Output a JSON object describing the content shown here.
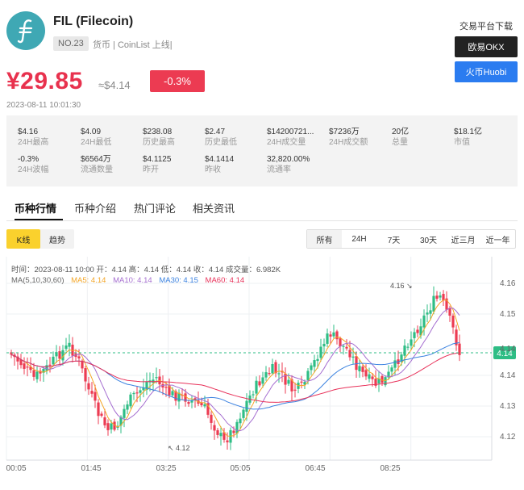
{
  "header": {
    "name": "FIL (Filecoin)",
    "rank": "NO.23",
    "tags": "货币 | CoinList 上线|",
    "price_cny": "¥29.85",
    "price_usd": "≈$4.14",
    "change": "-0.3%",
    "timestamp": "2023-08-11 10:01:30"
  },
  "exchange": {
    "title": "交易平台下载",
    "okx": "欧易OKX",
    "huobi": "火币Huobi"
  },
  "stats": [
    {
      "value": "$4.16",
      "label": "24H最高"
    },
    {
      "value": "$4.09",
      "label": "24H最低"
    },
    {
      "value": "$238.08",
      "label": "历史最高"
    },
    {
      "value": "$2.47",
      "label": "历史最低"
    },
    {
      "value": "$14200721...",
      "label": "24H成交量"
    },
    {
      "value": "$7236万",
      "label": "24H成交额"
    },
    {
      "value": "20亿",
      "label": "总量"
    },
    {
      "value": "$18.1亿",
      "label": "市值"
    },
    {
      "value": "-0.3%",
      "label": "24H波幅"
    },
    {
      "value": "$6564万",
      "label": "流通数量"
    },
    {
      "value": "$4.1125",
      "label": "昨开"
    },
    {
      "value": "$4.1414",
      "label": "昨收"
    },
    {
      "value": "32,820.00%",
      "label": "流通率"
    }
  ],
  "tabs": [
    "币种行情",
    "币种介绍",
    "热门评论",
    "相关资讯"
  ],
  "chart_types": [
    "K线",
    "趋势"
  ],
  "ranges": [
    "所有",
    "24H",
    "7天",
    "30天",
    "近三月",
    "近一年"
  ],
  "chart_info": {
    "line1": "时间：2023-08-11 10:00    开：4.14    高：4.14    低：4.14    收：4.14    成交量：6.982K",
    "ma_label": "MA(5,10,30,60)",
    "ma5": "MA5: 4.14",
    "ma10": "MA10: 4.14",
    "ma30": "MA30: 4.15",
    "ma60": "MA60: 4.14"
  },
  "chart_data": {
    "type": "candlestick",
    "ylim": [
      4.115,
      4.165
    ],
    "yticks": [
      "4.16",
      "4.15",
      "4.14",
      "4.14",
      "4.13",
      "4.12"
    ],
    "xticks": [
      "00:05",
      "01:45",
      "03:25",
      "05:05",
      "06:45",
      "08:25"
    ],
    "current_price": "4.14",
    "max_marker": "4.16",
    "min_marker": "4.12",
    "colors": {
      "up": "#2ebd85",
      "down": "#ec3b52",
      "ma5": "#f4a626",
      "ma10": "#a56ed0",
      "ma30": "#3b82e0",
      "ma60": "#e8325a"
    }
  }
}
